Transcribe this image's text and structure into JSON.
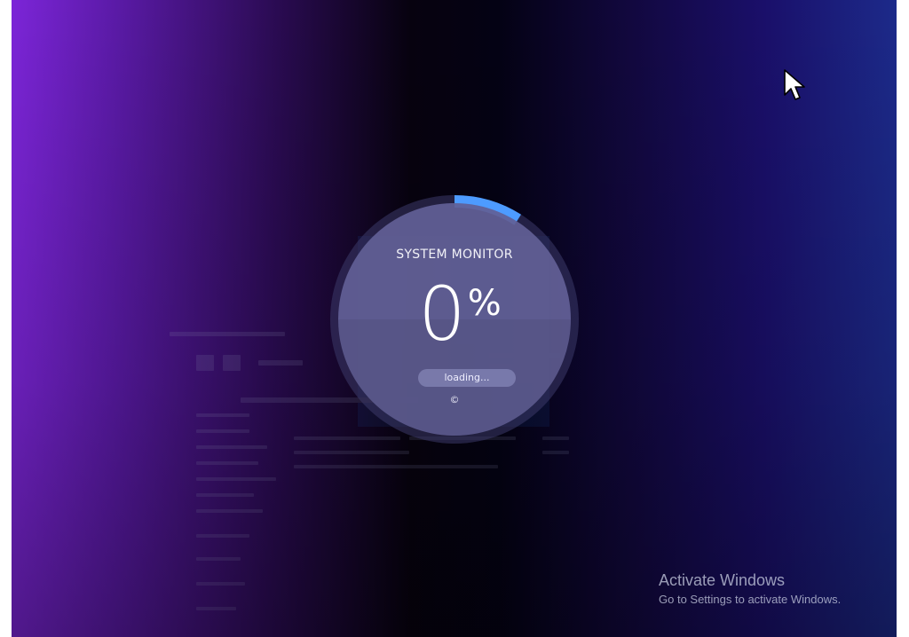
{
  "loader": {
    "title": "SYSTEM MONITOR",
    "percent_value": "0",
    "percent_sign": "%",
    "status_text": "loading...",
    "copyright_symbol": "©",
    "progress_arc_fraction": 0.09,
    "colors": {
      "accent": "#4d9bff",
      "ring": "#3c3a6a",
      "disc": "#626096"
    }
  },
  "watermark": {
    "title": "Activate Windows",
    "subtitle": "Go to Settings to activate Windows."
  },
  "icons": {
    "cursor": "mouse-pointer-icon"
  }
}
